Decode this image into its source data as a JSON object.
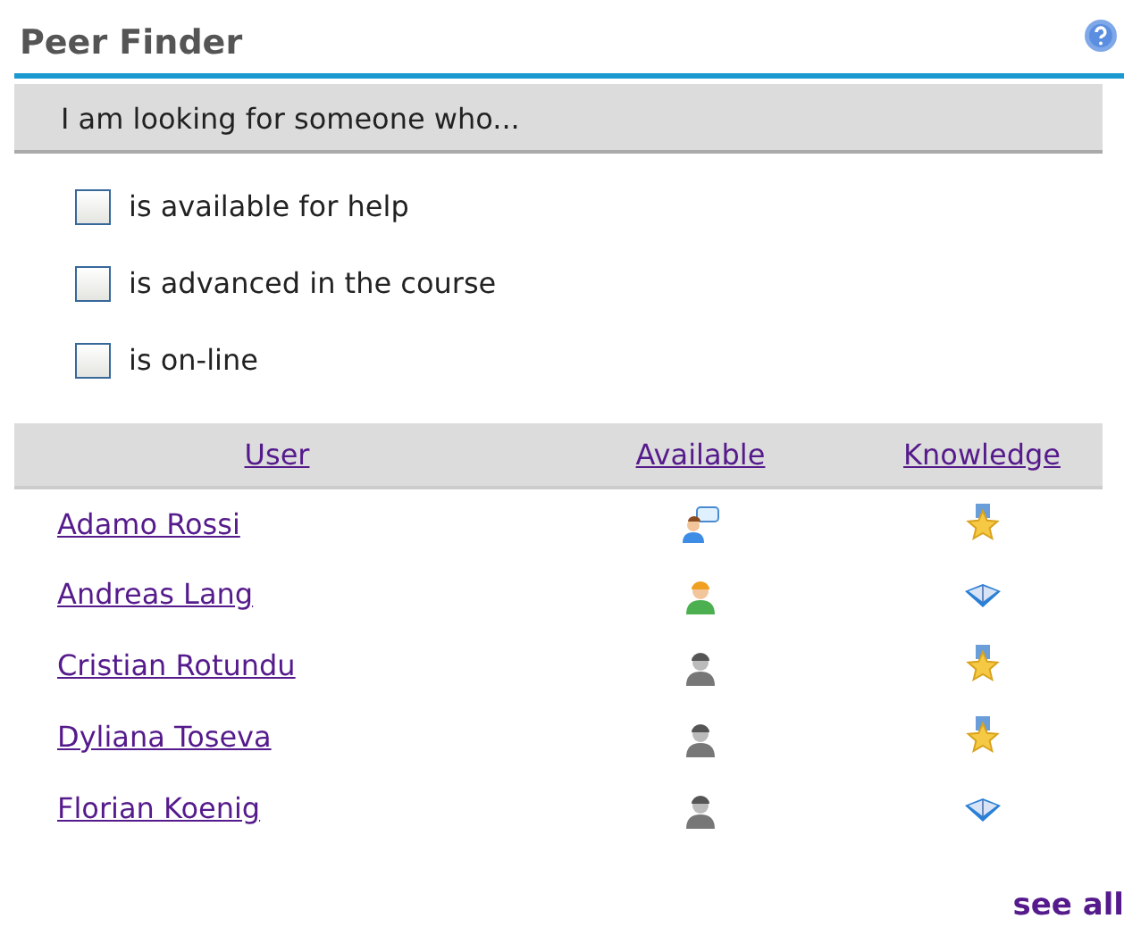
{
  "panel": {
    "title": "Peer Finder"
  },
  "filter": {
    "heading": "I am looking for someone who...",
    "options": [
      {
        "label": "is available for help",
        "checked": false
      },
      {
        "label": "is advanced in the course",
        "checked": false
      },
      {
        "label": "is on-line",
        "checked": false
      }
    ]
  },
  "table": {
    "columns": [
      "User",
      "Available",
      "Knowledge"
    ],
    "rows": [
      {
        "user": "Adamo Rossi",
        "availability": {
          "kind": "helping"
        },
        "knowledge": {
          "kind": "advanced"
        }
      },
      {
        "user": "Andreas Lang",
        "availability": {
          "kind": "online"
        },
        "knowledge": {
          "kind": "beginner"
        }
      },
      {
        "user": "Cristian Rotundu",
        "availability": {
          "kind": "offline"
        },
        "knowledge": {
          "kind": "advanced"
        }
      },
      {
        "user": "Dyliana Toseva",
        "availability": {
          "kind": "offline"
        },
        "knowledge": {
          "kind": "advanced"
        }
      },
      {
        "user": "Florian Koenig",
        "availability": {
          "kind": "offline"
        },
        "knowledge": {
          "kind": "beginner"
        }
      }
    ]
  },
  "footer_link": "see all"
}
